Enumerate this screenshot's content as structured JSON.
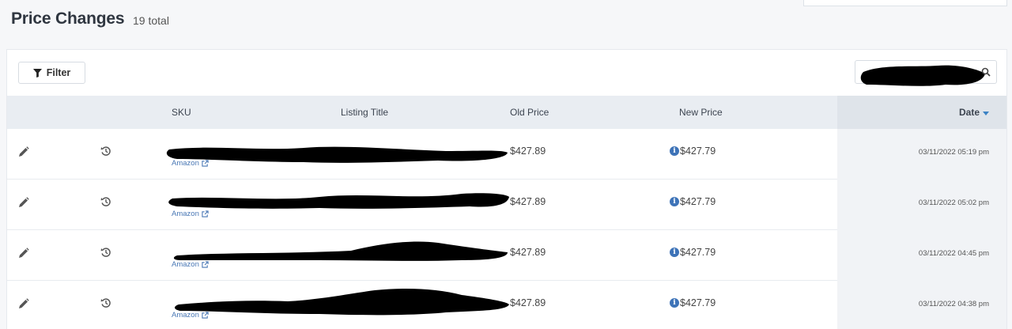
{
  "header": {
    "title": "Price Changes",
    "total": "19 total"
  },
  "toolbar": {
    "filter_label": "Filter"
  },
  "table": {
    "columns": {
      "sku": "SKU",
      "listing_title": "Listing Title",
      "old_price": "Old Price",
      "new_price": "New Price",
      "date": "Date"
    },
    "rows": [
      {
        "marketplace": "Amazon",
        "old_price": "$427.89",
        "new_price": "$427.79",
        "date": "03/11/2022 05:19 pm"
      },
      {
        "marketplace": "Amazon",
        "old_price": "$427.89",
        "new_price": "$427.79",
        "date": "03/11/2022 05:02 pm"
      },
      {
        "marketplace": "Amazon",
        "old_price": "$427.89",
        "new_price": "$427.79",
        "date": "03/11/2022 04:45 pm"
      },
      {
        "marketplace": "Amazon",
        "old_price": "$427.89",
        "new_price": "$427.79",
        "date": "03/11/2022 04:38 pm"
      }
    ]
  },
  "icons": {
    "info": "i"
  },
  "colors": {
    "accent": "#3b82c4",
    "link": "#4a78b5",
    "info": "#3d73b8"
  }
}
